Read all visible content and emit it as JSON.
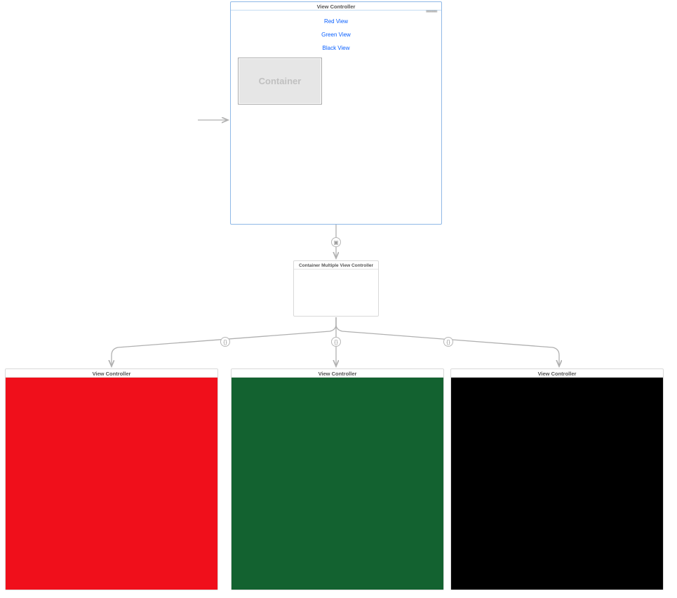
{
  "main": {
    "title": "View Controller",
    "status_label": "======",
    "buttons": {
      "red": "Red View",
      "green": "Green View",
      "black": "Black View"
    },
    "container_label": "Container"
  },
  "container_multiple": {
    "title": "Container Multiple View Controller"
  },
  "children": {
    "red": {
      "title": "View Controller",
      "color": "#F00F1B"
    },
    "green": {
      "title": "View Controller",
      "color": "#136230"
    },
    "black": {
      "title": "View Controller",
      "color": "#000000"
    }
  },
  "segues": {
    "embed_icon": "▣",
    "custom_icon": "{}"
  }
}
